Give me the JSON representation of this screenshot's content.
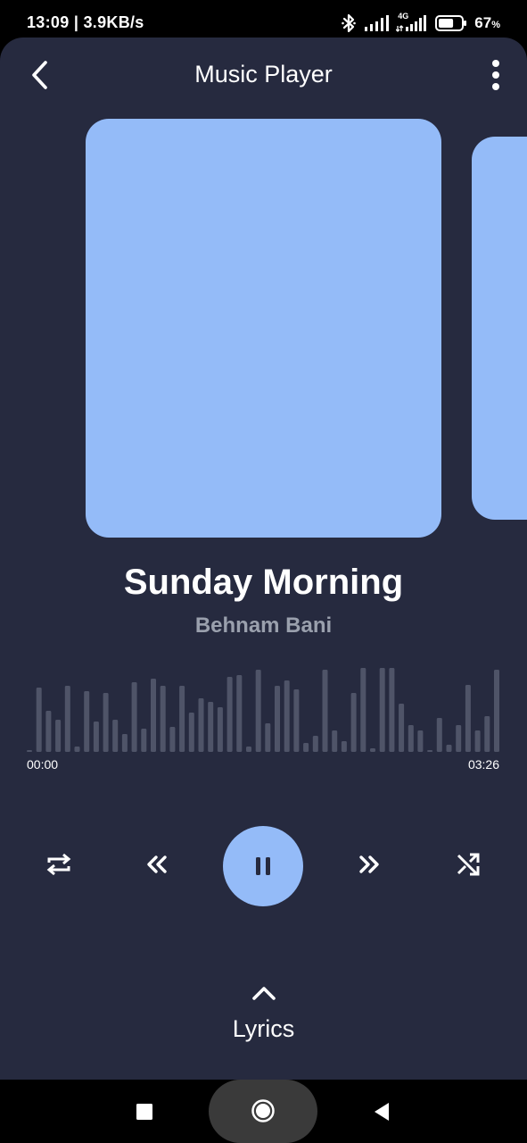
{
  "status_bar": {
    "time": "13:09 | 3.9KB/s",
    "network_type": "4G",
    "battery_percent": "67",
    "battery_unit": "%",
    "battery_level": 0.67
  },
  "header": {
    "title": "Music Player",
    "back_icon": "chevron-left-icon",
    "more_icon": "more-vertical-icon"
  },
  "colors": {
    "background": "#262a3f",
    "accent": "#94bbf8",
    "text_primary": "#ffffff",
    "text_secondary": "#9aa0ad"
  },
  "track": {
    "title": "Sunday Morning",
    "artist": "Behnam Bani"
  },
  "progress": {
    "elapsed": "00:00",
    "total": "03:26",
    "fraction": 0
  },
  "waveform": {
    "levels": [
      0.02,
      0.72,
      0.46,
      0.36,
      0.74,
      0.06,
      0.68,
      0.34,
      0.66,
      0.36,
      0.2,
      0.78,
      0.26,
      0.82,
      0.74,
      0.28,
      0.74,
      0.44,
      0.6,
      0.56,
      0.5,
      0.84,
      0.86,
      0.06,
      0.92,
      0.32,
      0.74,
      0.8,
      0.7,
      0.1,
      0.18,
      0.92,
      0.24,
      0.12,
      0.66,
      0.94,
      0.04,
      0.94,
      0.94,
      0.54,
      0.3,
      0.24,
      0.02,
      0.38,
      0.08,
      0.3,
      0.75,
      0.24,
      0.4,
      0.92
    ]
  },
  "controls": {
    "repeat_icon": "repeat-icon",
    "rewind_icon": "rewind-icon",
    "pause_icon": "pause-icon",
    "forward_icon": "fast-forward-icon",
    "shuffle_icon": "shuffle-icon"
  },
  "lyrics": {
    "label": "Lyrics",
    "icon": "chevron-up-icon"
  },
  "nav_bar": {
    "recents_icon": "square-icon",
    "home_icon": "circle-icon",
    "back_icon": "triangle-back-icon"
  }
}
